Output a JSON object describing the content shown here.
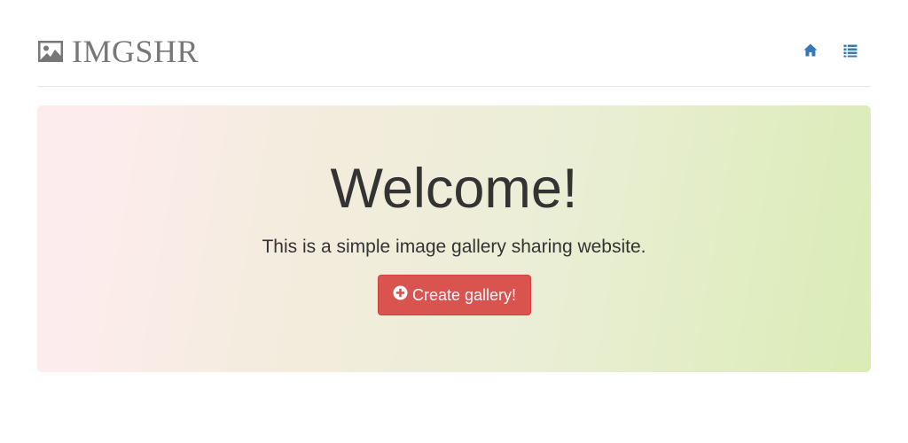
{
  "brand": {
    "name": "IMGSHR",
    "icon": "picture-icon"
  },
  "nav": {
    "items": [
      {
        "icon": "home-icon"
      },
      {
        "icon": "list-icon"
      }
    ],
    "link_color": "#337ab7"
  },
  "hero": {
    "title": "Welcome!",
    "lead": "This is a simple image gallery sharing website.",
    "button": {
      "label": "Create gallery!",
      "icon": "plus-circle-icon",
      "color": "#d9534f"
    }
  }
}
